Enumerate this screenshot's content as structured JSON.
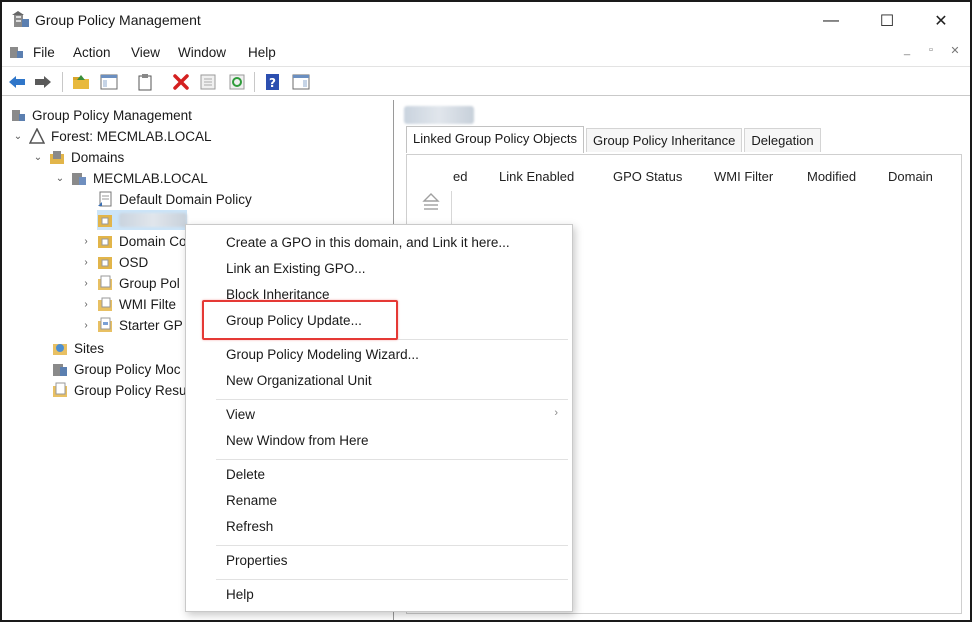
{
  "window": {
    "title": "Group Policy Management",
    "minimize": "—",
    "maximize": "☐",
    "close": "✕"
  },
  "menubar": {
    "items": [
      "File",
      "Action",
      "View",
      "Window",
      "Help"
    ],
    "mdi_controls": [
      "_",
      "▫",
      "✕"
    ]
  },
  "tree": {
    "root": "Group Policy Management",
    "forest": "Forest: MECMLAB.LOCAL",
    "domains": "Domains",
    "domain": "MECMLAB.LOCAL",
    "default_policy": "Default Domain Policy",
    "domain_controllers": "Domain Co",
    "osd": "OSD",
    "group_policy_objects": "Group Pol",
    "wmi_filters": "WMI Filte",
    "starter_gpos": "Starter GP",
    "sites": "Sites",
    "modeling": "Group Policy Moc",
    "results": "Group Policy Resu"
  },
  "right_pane": {
    "tabs": [
      "Linked Group Policy Objects",
      "Group Policy Inheritance",
      "Delegation"
    ],
    "columns": [
      "ed",
      "Link Enabled",
      "GPO Status",
      "WMI Filter",
      "Modified",
      "Domain"
    ]
  },
  "context_menu": {
    "items": [
      "Create a GPO in this domain, and Link it here...",
      "Link an Existing GPO...",
      "Block Inheritance",
      "Group Policy Update...",
      "Group Policy Modeling Wizard...",
      "New Organizational Unit",
      "View",
      "New Window from Here",
      "Delete",
      "Rename",
      "Refresh",
      "Properties",
      "Help"
    ],
    "submenu_arrow": "›",
    "highlight_color": "#e53935"
  }
}
